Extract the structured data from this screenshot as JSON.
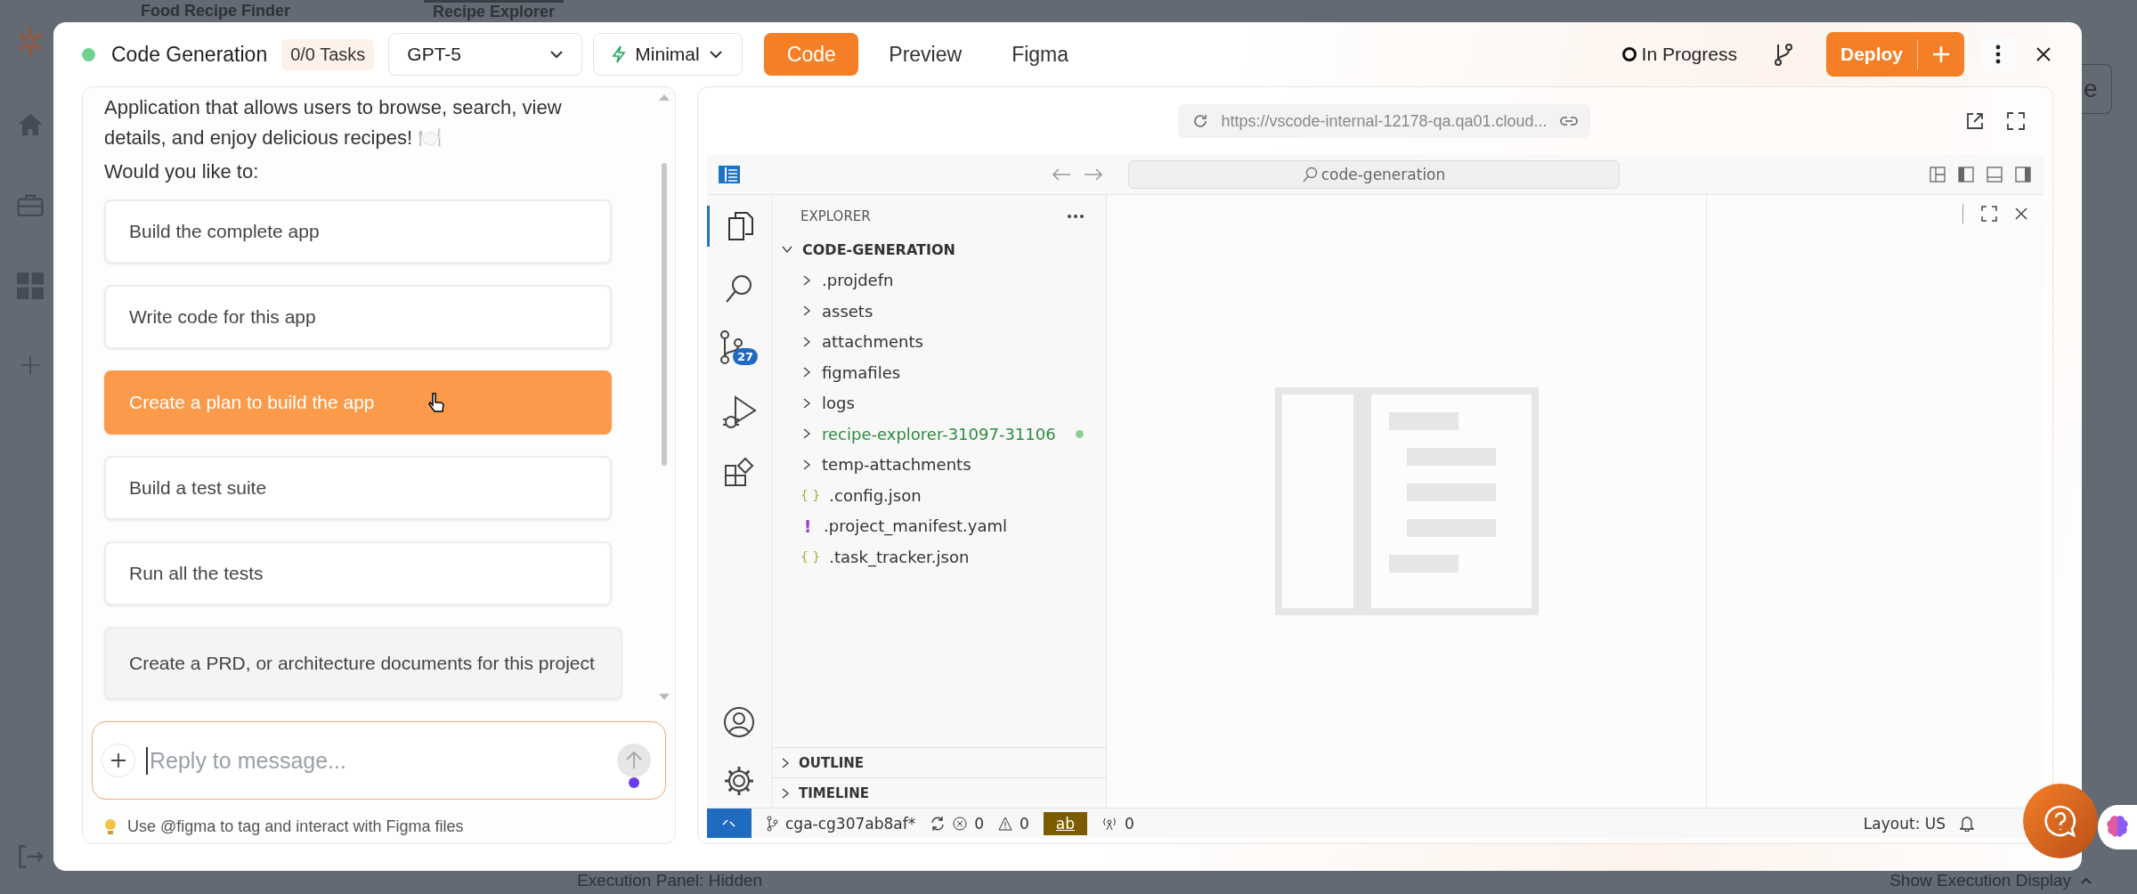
{
  "background": {
    "tabs": [
      {
        "label": "Food Recipe Finder",
        "selected": false
      },
      {
        "label": "Recipe Explorer",
        "selected": true
      }
    ],
    "side_button": "e",
    "footer_left": "Execution Panel: Hidden",
    "footer_right": "Show Execution Display"
  },
  "header": {
    "title": "Code Generation",
    "tasks": "0/0 Tasks",
    "model": "GPT-5",
    "mode": "Minimal",
    "tabs": [
      {
        "label": "Code",
        "selected": true
      },
      {
        "label": "Preview",
        "selected": false
      },
      {
        "label": "Figma",
        "selected": false
      }
    ],
    "status": "In Progress",
    "deploy": "Deploy"
  },
  "chat": {
    "message": "Application that allows users to browse, search, view details, and enjoy delicious recipes! 🍽️",
    "prompt": "Would you like to:",
    "options": [
      {
        "label": "Build the complete app",
        "kind": "action",
        "selected": false
      },
      {
        "label": "Write code for this app",
        "kind": "action",
        "selected": false
      },
      {
        "label": "Create a plan to build the app",
        "kind": "action",
        "selected": true
      },
      {
        "label": "Build a test suite",
        "kind": "action",
        "selected": false
      },
      {
        "label": "Run all the tests",
        "kind": "action",
        "selected": false
      },
      {
        "label": "Create a PRD, or architecture documents for this project",
        "kind": "document",
        "selected": false
      }
    ],
    "input": {
      "placeholder": "Reply to message..."
    },
    "hint": "Use @figma to tag and interact with Figma files"
  },
  "browser": {
    "url": "https://vscode-internal-12178-qa.qa01.cloud..."
  },
  "vscode": {
    "search": "code-generation",
    "source_control_badge": "27",
    "explorer_title": "EXPLORER",
    "tree": [
      {
        "label": "CODE-GENERATION",
        "kind": "root",
        "expanded": true,
        "children": [
          {
            "label": ".projdefn",
            "kind": "folder",
            "modified": false
          },
          {
            "label": "assets",
            "kind": "folder",
            "modified": false
          },
          {
            "label": "attachments",
            "kind": "folder",
            "modified": false
          },
          {
            "label": "figmafiles",
            "kind": "folder",
            "modified": false
          },
          {
            "label": "logs",
            "kind": "folder",
            "modified": false
          },
          {
            "label": "recipe-explorer-31097-31106",
            "kind": "folder",
            "modified": true
          },
          {
            "label": "temp-attachments",
            "kind": "folder",
            "modified": false
          },
          {
            "label": ".config.json",
            "kind": "json",
            "icon": "{ }",
            "modified": false
          },
          {
            "label": ".project_manifest.yaml",
            "kind": "yaml",
            "icon": "!",
            "modified": false
          },
          {
            "label": ".task_tracker.json",
            "kind": "json",
            "icon": "{ }",
            "modified": false
          }
        ]
      }
    ],
    "sections": [
      {
        "label": "OUTLINE",
        "expanded": false
      },
      {
        "label": "TIMELINE",
        "expanded": false
      }
    ],
    "status_bar": {
      "branch": "cga-cg307ab8af*",
      "errors": "0",
      "warnings": "0",
      "chip": "ab",
      "ports": "0",
      "layout": "Layout: US"
    }
  }
}
